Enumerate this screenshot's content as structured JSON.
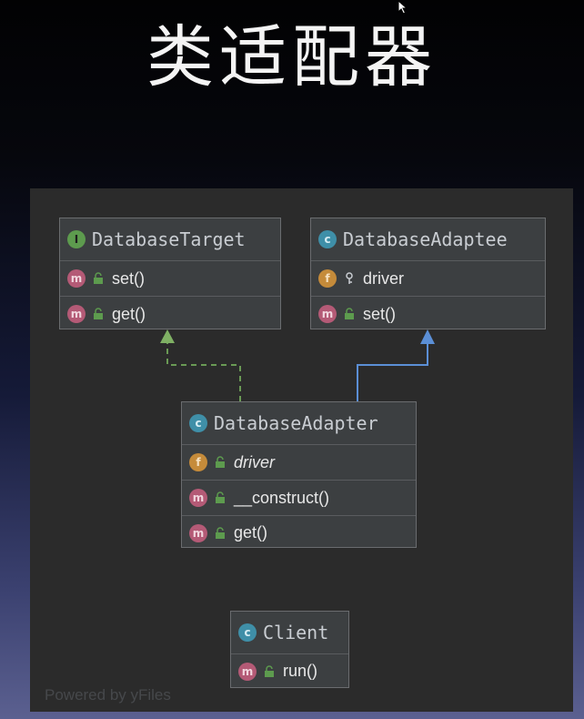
{
  "slide": {
    "title": "类适配器"
  },
  "diagram": {
    "watermark": "Powered by yFiles",
    "classes": {
      "target": {
        "name": "DatabaseTarget",
        "kind": "I",
        "members": [
          {
            "kind": "m",
            "label": "set()"
          },
          {
            "kind": "m",
            "label": "get()"
          }
        ]
      },
      "adaptee": {
        "name": "DatabaseAdaptee",
        "kind": "c",
        "members": [
          {
            "kind": "f",
            "label": "driver"
          },
          {
            "kind": "m",
            "label": "set()"
          }
        ]
      },
      "adapter": {
        "name": "DatabaseAdapter",
        "kind": "c",
        "members": [
          {
            "kind": "f",
            "label": "driver"
          },
          {
            "kind": "m",
            "label": "__construct()"
          },
          {
            "kind": "m",
            "label": "get()"
          }
        ]
      },
      "client": {
        "name": "Client",
        "kind": "c",
        "members": [
          {
            "kind": "m",
            "label": "run()"
          }
        ]
      }
    },
    "relations": [
      {
        "from": "adapter",
        "to": "target",
        "type": "implements",
        "color": "#6a9a55"
      },
      {
        "from": "adapter",
        "to": "adaptee",
        "type": "extends",
        "color": "#5b8fd6"
      }
    ]
  }
}
